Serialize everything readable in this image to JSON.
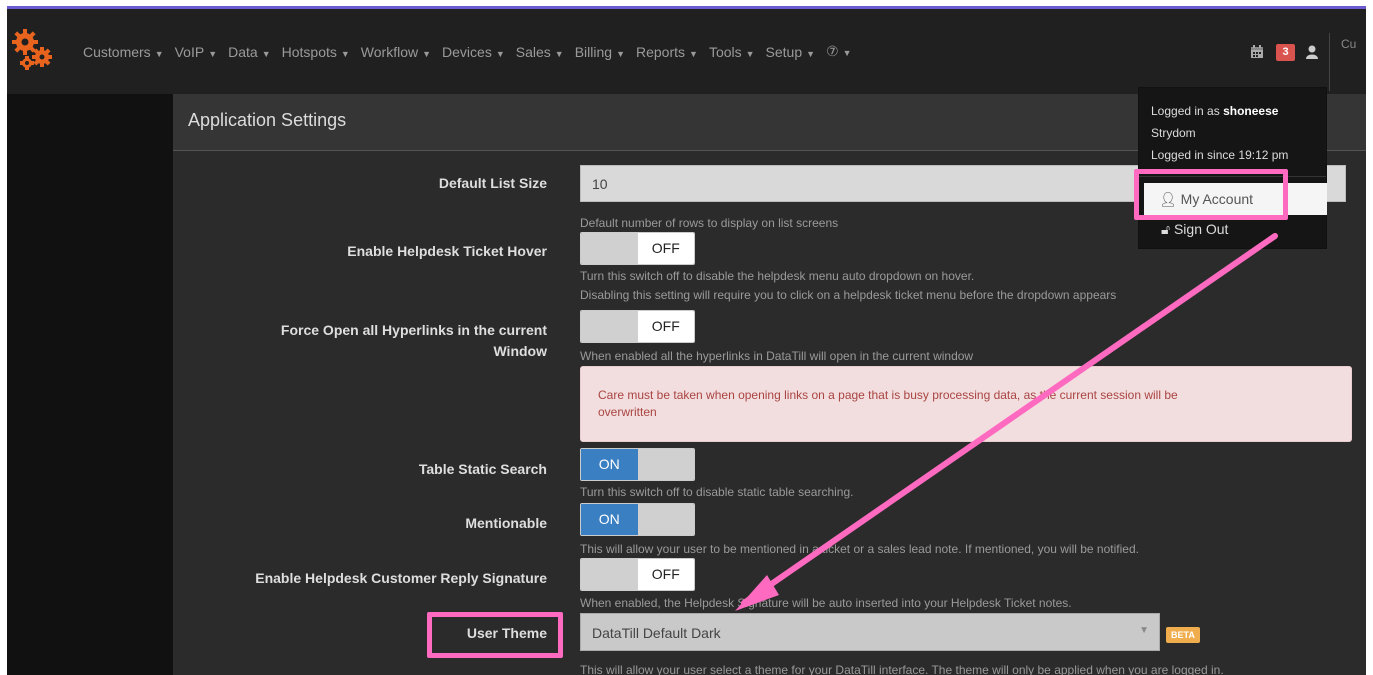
{
  "nav": {
    "items": [
      {
        "label": "Customers"
      },
      {
        "label": "VoIP"
      },
      {
        "label": "Data"
      },
      {
        "label": "Hotspots"
      },
      {
        "label": "Workflow"
      },
      {
        "label": "Devices"
      },
      {
        "label": "Sales"
      },
      {
        "label": "Billing"
      },
      {
        "label": "Reports"
      },
      {
        "label": "Tools"
      },
      {
        "label": "Setup"
      },
      {
        "label": "⑦"
      }
    ],
    "notification_count": "3",
    "cut_text": "Cu"
  },
  "panel": {
    "title": "Application Settings"
  },
  "settings": {
    "list_size": {
      "label": "Default List Size",
      "value": "10",
      "help": "Default number of rows to display on list screens"
    },
    "helpdesk_hover": {
      "label": "Enable Helpdesk Ticket Hover",
      "state": "OFF",
      "help1": "Turn this switch off to disable the helpdesk menu auto dropdown on hover.",
      "help2": "Disabling this setting will require you to click on a helpdesk ticket menu before the dropdown appears"
    },
    "force_open": {
      "label_line1": "Force Open all Hyperlinks in the current",
      "label_line2": "Window",
      "state": "OFF",
      "help": "When enabled all the hyperlinks in DataTill will open in the current window",
      "alert_line1": "Care must be taken when opening links on a page that is busy processing data, as the current session will be",
      "alert_line2": "overwritten"
    },
    "static_search": {
      "label": "Table Static Search",
      "state": "ON",
      "help": "Turn this switch off to disable static table searching."
    },
    "mentionable": {
      "label": "Mentionable",
      "state": "ON",
      "help": "This will allow your user to be mentioned in a ticket or a sales lead note. If mentioned, you will be notified."
    },
    "reply_signature": {
      "label": "Enable Helpdesk Customer Reply Signature",
      "state": "OFF",
      "help": "When enabled, the Helpdesk Signature will be auto inserted into your Helpdesk Ticket notes."
    },
    "user_theme": {
      "label": "User Theme",
      "value": "DataTill Default Dark",
      "badge": "BETA",
      "help": "This will allow your user select a theme for your DataTill interface. The theme will only be applied when you are logged in."
    }
  },
  "user_menu": {
    "logged_in_prefix": "Logged in as ",
    "username": "shoneese",
    "surname": "Strydom",
    "since": "Logged in since 19:12 pm",
    "my_account": "My Account",
    "sign_out": "Sign Out"
  },
  "colors": {
    "accent": "#ff6ac1",
    "toggle_on": "#3a7fc1",
    "badge": "#d9534f",
    "beta": "#f0ad4e"
  }
}
